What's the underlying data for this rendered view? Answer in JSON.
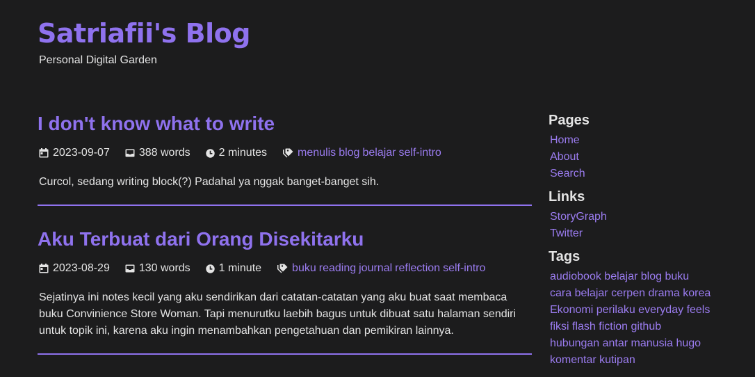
{
  "site": {
    "title": "Satriafii's Blog",
    "subtitle": "Personal Digital Garden"
  },
  "posts": [
    {
      "title": "I don't know what to write",
      "date": "2023-09-07",
      "words": "388 words",
      "reading_time": "2 minutes",
      "tags": [
        "menulis",
        "blog",
        "belajar",
        "self-intro"
      ],
      "summary": "Curcol, sedang writing block(?) Padahal ya nggak banget-banget sih."
    },
    {
      "title": "Aku Terbuat dari Orang Disekitarku",
      "date": "2023-08-29",
      "words": "130 words",
      "reading_time": "1 minute",
      "tags": [
        "buku",
        "reading",
        "journal",
        "reflection",
        "self-intro"
      ],
      "summary": "Sejatinya ini notes kecil yang aku sendirikan dari catatan-catatan yang aku buat saat membaca buku Convinience Store Woman. Tapi menurutku laebih bagus untuk dibuat satu halaman sendiri untuk topik ini, karena aku ingin menambahkan pengetahuan dan pemikiran lainnya."
    }
  ],
  "sidebar": {
    "pages_heading": "Pages",
    "pages": [
      "Home",
      "About",
      "Search"
    ],
    "links_heading": "Links",
    "links": [
      "StoryGraph",
      "Twitter"
    ],
    "tags_heading": "Tags",
    "tags": [
      "audiobook",
      "belajar",
      "blog",
      "buku",
      "cara belajar",
      "cerpen",
      "drama korea",
      "Ekonomi",
      "perilaku everyday",
      "feels",
      "fiksi",
      "flash fiction",
      "github",
      "hubungan antar manusia",
      "hugo",
      "komentar",
      "kutipan"
    ]
  },
  "icons": {
    "date": "calendar-icon",
    "words": "inbox-icon",
    "reading_time": "clock-icon",
    "tags": "tag-icon"
  },
  "colors": {
    "background": "#1c1c1d",
    "accent": "#8f72ee",
    "link": "#9b7cf0",
    "text": "#e4e4e4"
  }
}
